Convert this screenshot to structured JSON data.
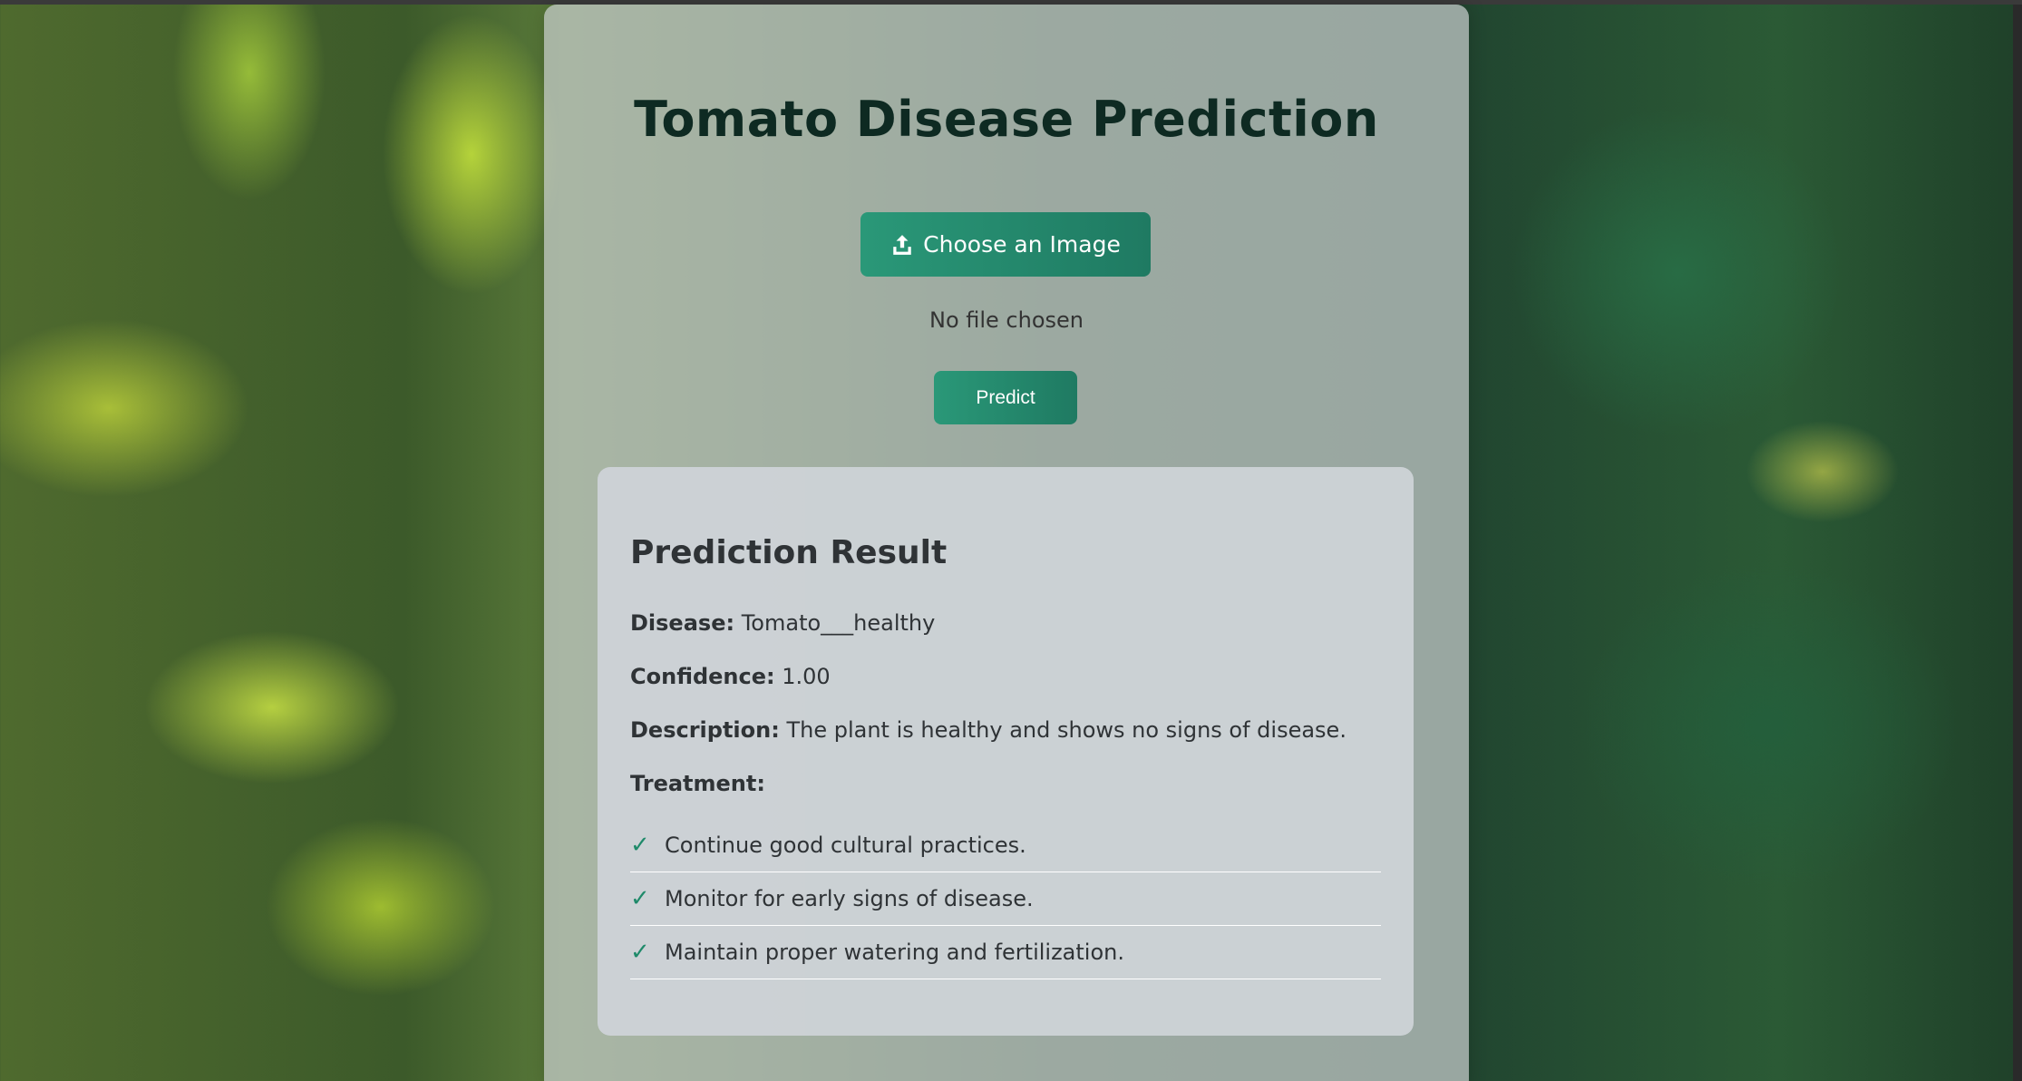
{
  "app": {
    "title": "Tomato Disease Prediction"
  },
  "upload": {
    "choose_label": "Choose an Image",
    "choose_icon": "upload-icon",
    "file_status": "No file chosen"
  },
  "actions": {
    "predict_label": "Predict"
  },
  "result": {
    "heading": "Prediction Result",
    "disease_label": "Disease:",
    "disease_value": "Tomato___healthy",
    "confidence_label": "Confidence:",
    "confidence_value": "1.00",
    "description_label": "Description:",
    "description_value": "The plant is healthy and shows no signs of disease.",
    "treatment_label": "Treatment:",
    "treatment_icon": "check-icon",
    "treatments": [
      "Continue good cultural practices.",
      "Monitor for early signs of disease.",
      "Maintain proper watering and fertilization."
    ]
  },
  "colors": {
    "accent": "#1f7a62",
    "check": "#1f8a6a",
    "title": "#0e2a22"
  }
}
